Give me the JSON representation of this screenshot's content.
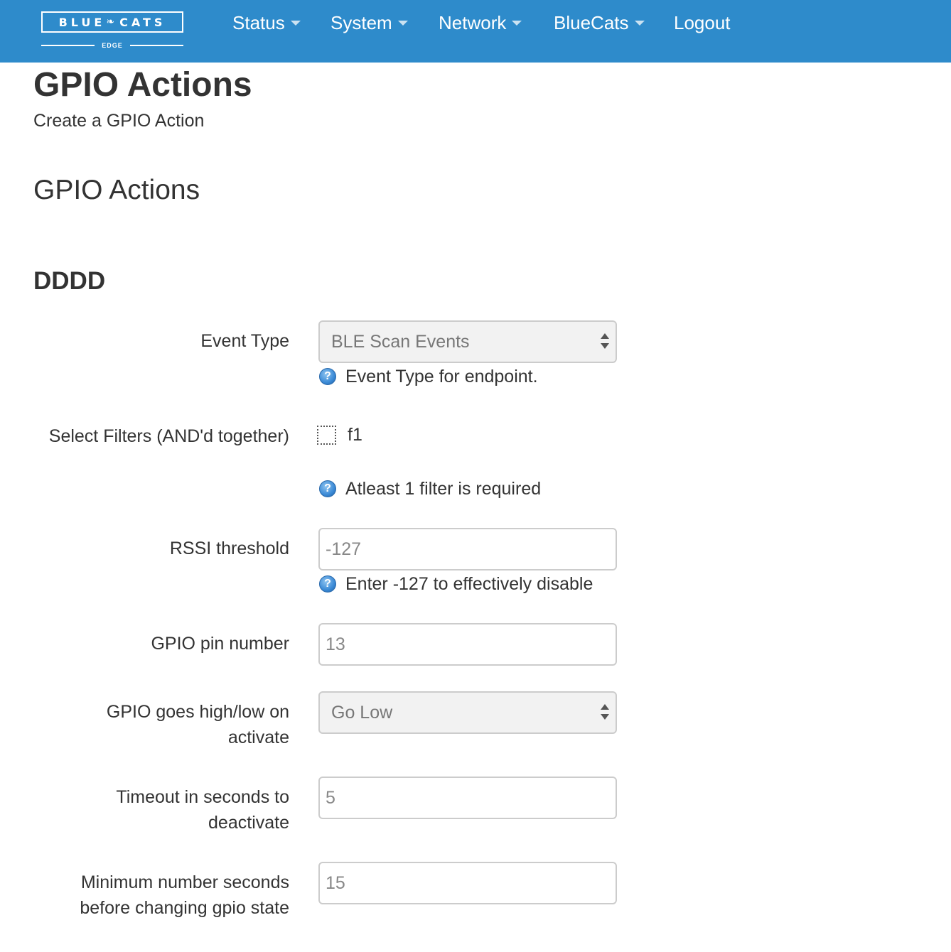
{
  "navbar": {
    "brand": {
      "left_word": "BLUE",
      "right_word": "CATS",
      "subtitle": "EDGE",
      "logo_icon": "leaf-icon"
    },
    "items": [
      {
        "label": "Status",
        "has_dropdown": true
      },
      {
        "label": "System",
        "has_dropdown": true
      },
      {
        "label": "Network",
        "has_dropdown": true
      },
      {
        "label": "BlueCats",
        "has_dropdown": true
      },
      {
        "label": "Logout",
        "has_dropdown": false
      }
    ],
    "color": "#2e8bcb"
  },
  "page": {
    "title": "GPIO Actions",
    "subtitle": "Create a GPIO Action",
    "section_title": "GPIO Actions",
    "group_title": "DDDD"
  },
  "form": {
    "event_type": {
      "label": "Event Type",
      "selected": "BLE Scan Events",
      "help": "Event Type for endpoint."
    },
    "filters": {
      "label": "Select Filters (AND'd together)",
      "options": [
        {
          "label": "f1",
          "checked": false
        }
      ],
      "help": "Atleast 1 filter is required"
    },
    "rssi": {
      "label": "RSSI threshold",
      "value": "-127",
      "help": "Enter -127 to effectively disable"
    },
    "gpio_pin": {
      "label": "GPIO pin number",
      "value": "13"
    },
    "gpio_state": {
      "label_line1": "GPIO goes high/low on",
      "label_line2": "activate",
      "selected": "Go Low"
    },
    "timeout": {
      "label_line1": "Timeout in seconds to",
      "label_line2": "deactivate",
      "value": "5"
    },
    "min_seconds": {
      "label_line1": "Minimum number seconds",
      "label_line2": "before changing gpio state",
      "value": "15"
    }
  },
  "icons": {
    "help": "help-icon",
    "help_glyph": "?"
  }
}
